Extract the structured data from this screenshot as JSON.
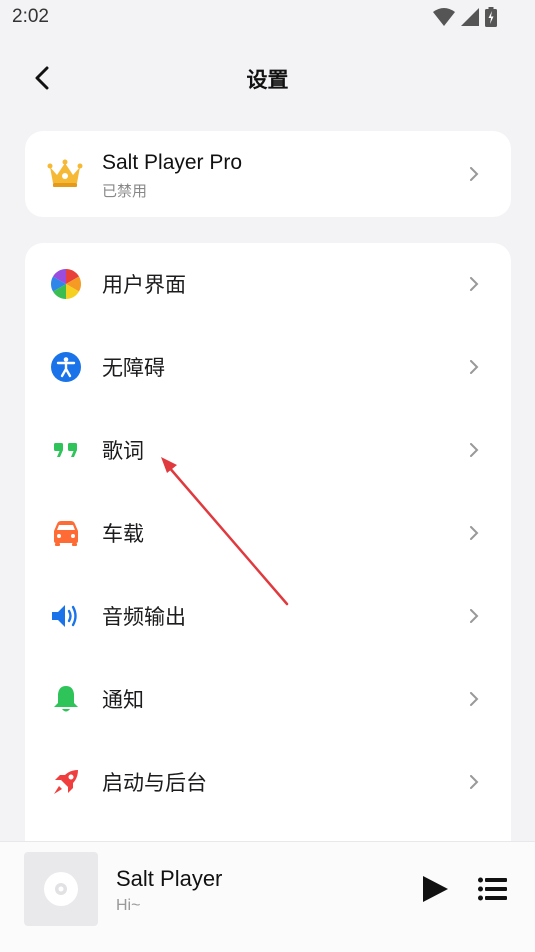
{
  "status_bar": {
    "time": "2:02"
  },
  "header": {
    "title": "设置"
  },
  "pro": {
    "title": "Salt Player Pro",
    "subtitle": "已禁用"
  },
  "settings": {
    "items": [
      {
        "label": "用户界面",
        "icon": "color-wheel-icon"
      },
      {
        "label": "无障碍",
        "icon": "accessibility-icon"
      },
      {
        "label": "歌词",
        "icon": "quote-icon"
      },
      {
        "label": "车载",
        "icon": "car-icon"
      },
      {
        "label": "音频输出",
        "icon": "speaker-icon"
      },
      {
        "label": "通知",
        "icon": "bell-icon"
      },
      {
        "label": "启动与后台",
        "icon": "rocket-icon"
      }
    ]
  },
  "player": {
    "title": "Salt Player",
    "subtitle": "Hi~"
  },
  "colors": {
    "background": "#f3f3f5",
    "card": "#ffffff",
    "accent_blue": "#1a73e8",
    "green": "#2ec45a",
    "orange": "#ff6b35",
    "red": "#f03e3e",
    "annotation_arrow": "#e0393e"
  }
}
